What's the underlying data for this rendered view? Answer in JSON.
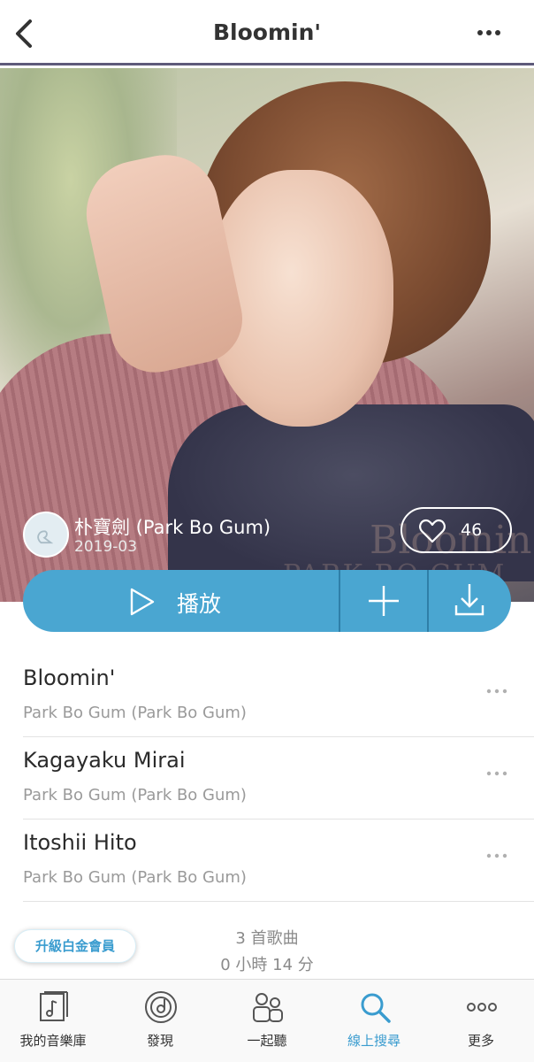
{
  "header": {
    "title": "Bloomin'",
    "back_icon": "chevron-left-icon",
    "more_icon": "more-horizontal-icon"
  },
  "album": {
    "artist": "朴寶劍 (Park Bo Gum)",
    "date": "2019-03",
    "likes": "46",
    "cover_text_1": "Bloomin'",
    "cover_text_2": "PARK BO GUM"
  },
  "actions": {
    "play_label": "播放",
    "add_icon": "plus-icon",
    "download_icon": "download-icon"
  },
  "songs": [
    {
      "title": "Bloomin'",
      "artist": "Park Bo Gum (Park Bo Gum)"
    },
    {
      "title": "Kagayaku Mirai",
      "artist": "Park Bo Gum (Park Bo Gum)"
    },
    {
      "title": "Itoshii Hito",
      "artist": "Park Bo Gum (Park Bo Gum)"
    }
  ],
  "summary": {
    "upgrade_label": "升級白金會員",
    "count": "3 首歌曲",
    "duration": "0 小時 14 分"
  },
  "tabs": [
    {
      "label": "我的音樂庫",
      "icon": "music-library-icon",
      "active": false
    },
    {
      "label": "發現",
      "icon": "disc-icon",
      "active": false
    },
    {
      "label": "一起聽",
      "icon": "people-icon",
      "active": false
    },
    {
      "label": "線上搜尋",
      "icon": "search-icon",
      "active": true
    },
    {
      "label": "更多",
      "icon": "more-icon",
      "active": false
    }
  ],
  "colors": {
    "accent": "#4aa6d1",
    "tab_active": "#3a9ccf"
  }
}
